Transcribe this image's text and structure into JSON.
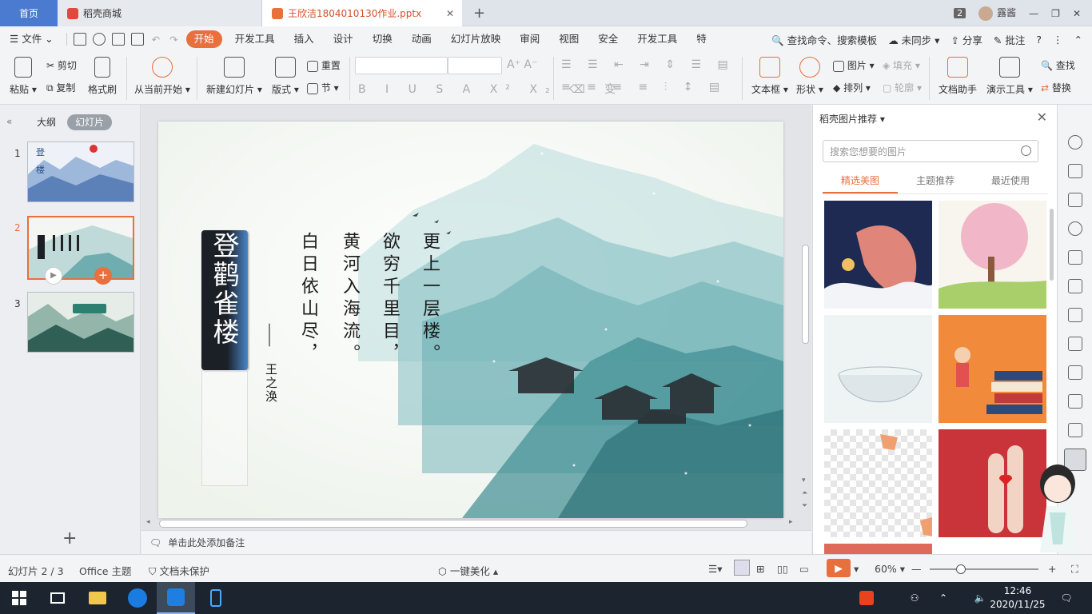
{
  "tabs": {
    "home": "首页",
    "store": "稻壳商城",
    "doc": "王欣洁1804010130作业.pptx",
    "window_count": "2",
    "user": "露酱"
  },
  "menu": {
    "file": "文件",
    "items": [
      "开始",
      "开发工具",
      "插入",
      "设计",
      "切换",
      "动画",
      "幻灯片放映",
      "审阅",
      "视图",
      "安全",
      "开发工具",
      "特"
    ],
    "search": "查找命令、搜索模板",
    "unsync": "未同步",
    "share": "分享",
    "comment": "批注"
  },
  "ribbon": {
    "paste": "粘贴",
    "cut": "剪切",
    "copy": "复制",
    "format_painter": "格式刷",
    "play_from_current": "从当前开始",
    "new_slide": "新建幻灯片",
    "layout": "版式",
    "reset": "重置",
    "section": "节",
    "text_box": "文本框",
    "shape": "形状",
    "picture": "图片",
    "fill": "填充",
    "arrange": "排列",
    "outline": "轮廓",
    "doc_helper": "文档助手",
    "present_tools": "演示工具",
    "find": "查找",
    "replace": "替换"
  },
  "left_panel": {
    "outline_tab": "大纲",
    "slides_tab": "幻灯片",
    "slide_numbers": [
      "1",
      "2",
      "3"
    ]
  },
  "slide": {
    "title": "登鹳雀楼",
    "poem_lines": [
      "白日依山尽，",
      "黄河入海流。",
      "欲穷千里目，",
      "更上一层楼。"
    ],
    "author_dash": "——",
    "author": "王之涣"
  },
  "notes_placeholder": "单击此处添加备注",
  "right_panel": {
    "title": "稻壳图片推荐",
    "search_placeholder": "搜索您想要的图片",
    "tabs": [
      "精选美图",
      "主题推荐",
      "最近使用"
    ]
  },
  "status": {
    "slide_indicator": "幻灯片 2 / 3",
    "theme": "Office 主题",
    "protection": "文档未保护",
    "beautify": "一键美化",
    "zoom": "60%"
  },
  "taskbar": {
    "time": "12:46",
    "date": "2020/11/25"
  },
  "colors": {
    "accent": "#e8703d",
    "home_tab": "#4a7bd0",
    "title_bar_dark": "#1b1f26",
    "title_bar_blue": "#4a86c8"
  }
}
